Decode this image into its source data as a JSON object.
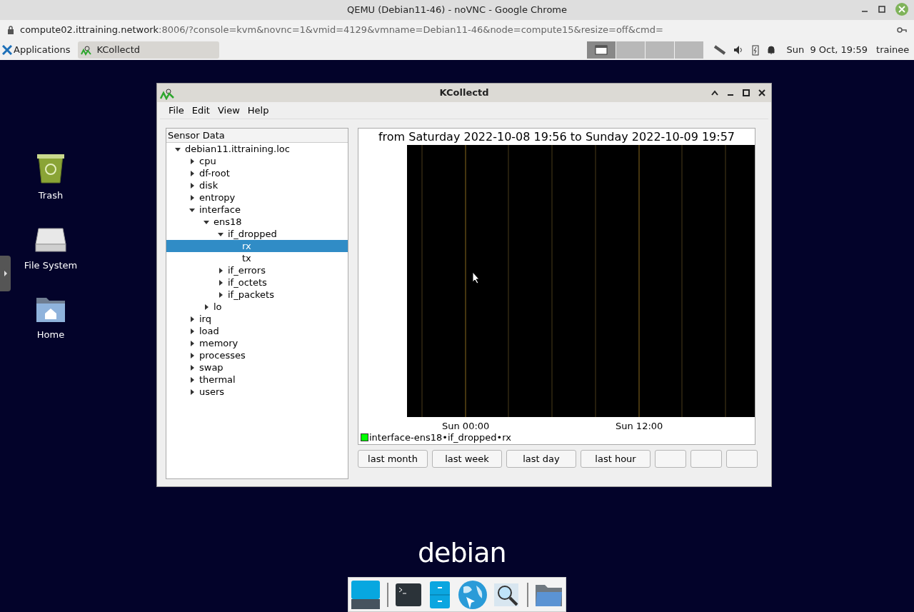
{
  "browser": {
    "title": "QEMU (Debian11-46) - noVNC - Google Chrome",
    "url_host": "compute02.ittraining.network",
    "url_rest": ":8006/?console=kvm&novnc=1&vmid=4129&vmname=Debian11-46&node=compute15&resize=off&cmd="
  },
  "panel": {
    "apps_label": "Applications",
    "task": "KCollectd",
    "clock": "Sun  9 Oct, 19:59",
    "user": "trainee"
  },
  "desktop_icons": [
    {
      "kind": "trash",
      "label": "Trash"
    },
    {
      "kind": "drive",
      "label": "File System"
    },
    {
      "kind": "home",
      "label": "Home"
    }
  ],
  "window": {
    "title": "KCollectd",
    "menu": [
      "File",
      "Edit",
      "View",
      "Help"
    ],
    "tree_header": "Sensor Data",
    "tree": [
      {
        "label": "debian11.ittraining.loc",
        "expanded": true,
        "selected": false,
        "children": [
          {
            "label": "cpu",
            "expanded": false,
            "selected": false
          },
          {
            "label": "df-root",
            "expanded": false,
            "selected": false
          },
          {
            "label": "disk",
            "expanded": false,
            "selected": false
          },
          {
            "label": "entropy",
            "expanded": false,
            "selected": false
          },
          {
            "label": "interface",
            "expanded": true,
            "selected": false,
            "children": [
              {
                "label": "ens18",
                "expanded": true,
                "selected": false,
                "children": [
                  {
                    "label": "if_dropped",
                    "expanded": true,
                    "selected": false,
                    "children": [
                      {
                        "label": "rx",
                        "selected": true
                      },
                      {
                        "label": "tx",
                        "selected": false
                      }
                    ]
                  },
                  {
                    "label": "if_errors",
                    "expanded": false,
                    "selected": false
                  },
                  {
                    "label": "if_octets",
                    "expanded": false,
                    "selected": false
                  },
                  {
                    "label": "if_packets",
                    "expanded": false,
                    "selected": false
                  }
                ]
              },
              {
                "label": "lo",
                "expanded": false,
                "selected": false
              }
            ]
          },
          {
            "label": "irq",
            "expanded": false,
            "selected": false
          },
          {
            "label": "load",
            "expanded": false,
            "selected": false
          },
          {
            "label": "memory",
            "expanded": false,
            "selected": false
          },
          {
            "label": "processes",
            "expanded": false,
            "selected": false
          },
          {
            "label": "swap",
            "expanded": false,
            "selected": false
          },
          {
            "label": "thermal",
            "expanded": false,
            "selected": false
          },
          {
            "label": "users",
            "expanded": false,
            "selected": false
          }
        ]
      }
    ],
    "graph": {
      "title": "from Saturday 2022-10-08 19:56 to Sunday 2022-10-09 19:57",
      "x_labels": [
        "Sun 00:00",
        "Sun 12:00"
      ],
      "legend": {
        "label": "interface-ens18•if_dropped•rx",
        "color": "#00ff00"
      }
    },
    "buttons": [
      {
        "kind": "labeled",
        "label": "last month"
      },
      {
        "kind": "labeled",
        "label": "last week"
      },
      {
        "kind": "labeled",
        "label": "last day"
      },
      {
        "kind": "labeled",
        "label": "last hour"
      },
      {
        "kind": "blank"
      },
      {
        "kind": "blank"
      },
      {
        "kind": "blank"
      }
    ]
  },
  "debian_logo": "debian"
}
